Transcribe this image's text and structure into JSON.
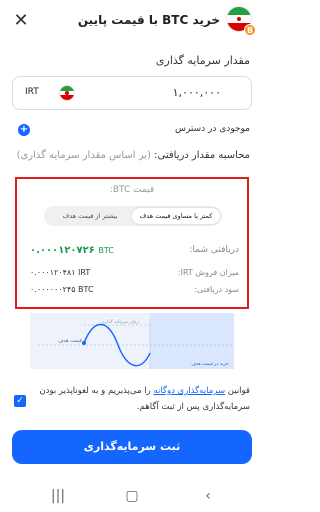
{
  "header": {
    "title": "خرید BTC با قیمت پایین",
    "close_icon": "close-icon",
    "flag_icon": "iran-flag-icon",
    "btc_badge": "B"
  },
  "investment": {
    "label": "مقدار سرمایه گذاری",
    "currency": "IRT",
    "amount": "۱,۰۰۰,۰۰۰"
  },
  "available": {
    "label": "موجودی در دسترس",
    "plus_icon": "+"
  },
  "calculation": {
    "label": "محاسبه مقدار دریافتی:",
    "hint": "(بر اساس مقدار سرمایه گذاری)"
  },
  "price_box": {
    "price_label": "قیمت BTC:",
    "toggle": {
      "selected": "کمتر یا مساوی قیمت هدف",
      "other": "بیشتر از قیمت هدف"
    },
    "rows": [
      {
        "label": "دریافتی شما:",
        "value": "۰.۰۰۰۱۲۰۷۲۶",
        "unit": "BTC"
      },
      {
        "label": "میزان فروش IRT:",
        "value": "۰.۰۰۰۱۲۰۴۸۱ IRT"
      },
      {
        "label": "سود دریافتی:",
        "value": "۰.۰۰۰۰۰۰۲۴۵ BTC"
      }
    ]
  },
  "chart": {
    "target_price_label": "قیمت هدف",
    "buy_label": "خرید در قیمت هدف",
    "period_label": "زمان سرمایه گذاری",
    "accent_color": "#1565ff"
  },
  "consent": {
    "prefix": "قوانین",
    "link": "سرمایه‌گذاری دوگانه",
    "suffix": "را می‌پذیریم و به لغوناپذیر بودن سرمایه‌گذاری پس از ثبت آگاهم."
  },
  "submit": {
    "label": "ثبت سرمایه‌گذاری",
    "color": "#1565ff"
  },
  "navbar": {
    "recent_icon": "|||",
    "home_icon": "▢",
    "back_icon": "‹"
  },
  "colors": {
    "accent": "#1565ff",
    "highlight_border": "#e01e1e",
    "positive": "#159a4b"
  }
}
